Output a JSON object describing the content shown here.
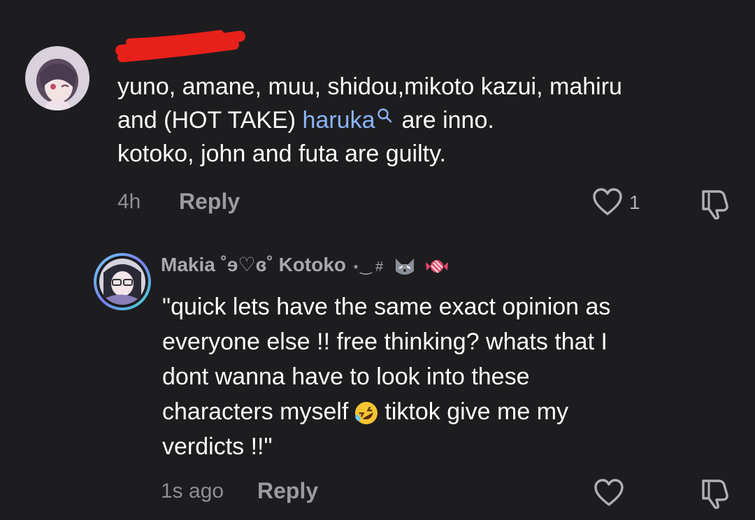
{
  "comments": [
    {
      "text_line1": "yuno, amane, muu, shidou,mikoto kazui, mahiru",
      "text_line2_before": "and (HOT TAKE) ",
      "mention": "haruka",
      "text_line2_after": "are inno.",
      "text_line3": "kotoko, john and futa are guilty.",
      "time": "4h",
      "reply_label": "Reply",
      "like_count": "1"
    },
    {
      "username": "Makia ˚ɘ♡ɞ˚ Kotoko",
      "username_suffix": "⋆‿ #",
      "text_line1": "\"quick lets have the same exact opinion as",
      "text_line2": "everyone else !! free thinking? whats that I",
      "text_line3": "dont wanna have to look into these",
      "text_line4_before": "characters myself",
      "text_line4_after": "tiktok give me my",
      "text_line5": "verdicts !!\"",
      "time": "1s ago",
      "reply_label": "Reply"
    }
  ],
  "colors": {
    "background": "#1d1d1f",
    "text": "#ffffff",
    "mention": "#8ab4f8",
    "meta": "#8e8e93",
    "redaction": "#e8201a"
  },
  "icons": [
    "avatar",
    "redaction-scribble",
    "search-icon",
    "heart-icon",
    "dislike-icon",
    "cat-emoji",
    "candy-emoji",
    "rofl-emoji"
  ]
}
